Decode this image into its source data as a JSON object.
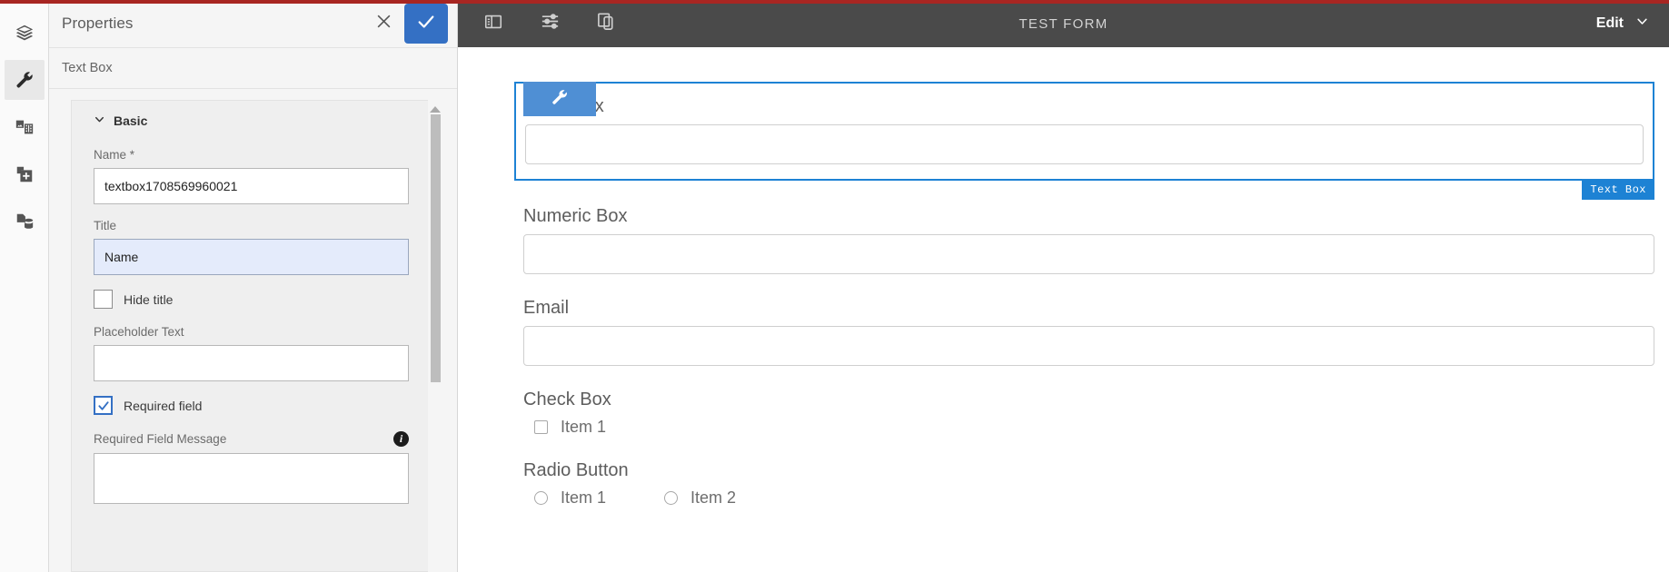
{
  "theme": {
    "accent_red": "#a82622",
    "primary_blue": "#3470c4",
    "select_blue": "#1d82d4",
    "topbar_gray": "#4a4a4a"
  },
  "rail": {
    "items": [
      {
        "icon": "layers-icon",
        "active": false
      },
      {
        "icon": "wrench-icon",
        "active": true
      },
      {
        "icon": "media-icon",
        "active": false
      },
      {
        "icon": "add-component-icon",
        "active": false
      },
      {
        "icon": "data-source-icon",
        "active": false
      }
    ]
  },
  "properties": {
    "title": "Properties",
    "close_icon": "close-icon",
    "confirm_icon": "check-icon",
    "subtype": "Text Box",
    "group": {
      "label": "Basic",
      "chevron": "chevron-down-icon"
    },
    "fields": {
      "name": {
        "label": "Name *",
        "value": "textbox1708569960021",
        "placeholder": ""
      },
      "title": {
        "label": "Title",
        "value": "Name",
        "placeholder": "",
        "focused": true
      },
      "hide_title": {
        "label": "Hide title",
        "checked": false
      },
      "placeholder_text": {
        "label": "Placeholder Text",
        "value": "",
        "placeholder": ""
      },
      "required_field": {
        "label": "Required field",
        "checked": true
      },
      "required_field_message": {
        "label": "Required Field Message",
        "value": "",
        "placeholder": "",
        "info_icon": "info-icon"
      }
    }
  },
  "topbar": {
    "tools": [
      {
        "icon": "panel-toggle-icon",
        "name": "toggle-panel-button"
      },
      {
        "icon": "sliders-icon",
        "name": "form-settings-button"
      },
      {
        "icon": "device-preview-icon",
        "name": "device-preview-button"
      }
    ],
    "title": "TEST FORM",
    "mode": {
      "label": "Edit",
      "chevron": "chevron-down-icon"
    }
  },
  "canvas": {
    "selected": {
      "label": "Text Box",
      "badge": "Text Box",
      "tab_icon": "wrench-icon",
      "value": "",
      "placeholder": ""
    },
    "fields": [
      {
        "type": "numeric",
        "label": "Numeric Box",
        "value": "",
        "placeholder": ""
      },
      {
        "type": "email",
        "label": "Email",
        "value": "",
        "placeholder": ""
      }
    ],
    "checkbox_group": {
      "label": "Check Box",
      "options": [
        {
          "label": "Item 1",
          "checked": false
        }
      ]
    },
    "radio_group": {
      "label": "Radio Button",
      "options": [
        {
          "label": "Item 1",
          "checked": false
        },
        {
          "label": "Item 2",
          "checked": false
        }
      ]
    }
  }
}
